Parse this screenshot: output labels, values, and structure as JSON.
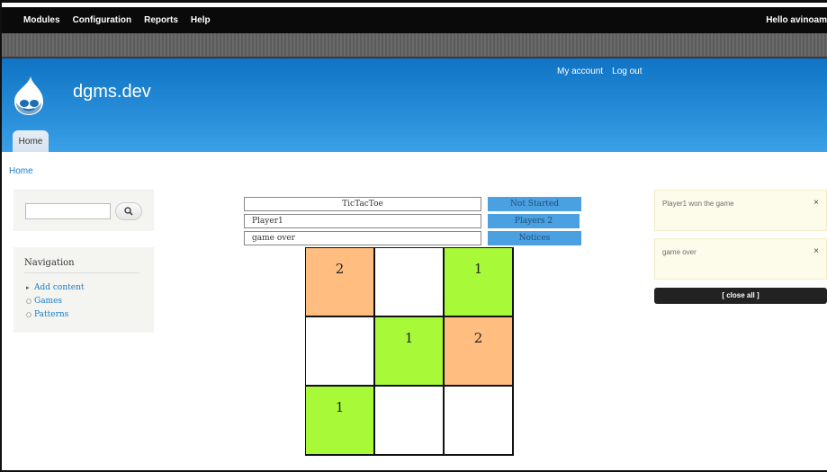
{
  "admin_bar": {
    "menu": [
      "Modules",
      "Configuration",
      "Reports",
      "Help"
    ],
    "hello_prefix": "Hello ",
    "username": "avinoam"
  },
  "header": {
    "site_name": "dgms.dev",
    "my_account": "My account",
    "log_out": "Log out",
    "tab_home": "Home",
    "logo_icon": "drupal-drop-icon"
  },
  "breadcrumb": "Home",
  "search": {
    "value": "",
    "button_icon": "search-icon"
  },
  "navigation": {
    "title": "Navigation",
    "items": [
      "Add content",
      "Games",
      "Patterns"
    ]
  },
  "game": {
    "name": "TicTacToe",
    "player": "Player1",
    "status_text": "game over",
    "state_button": "Not Started",
    "players_button": "Players 2",
    "notices_button": "Notices"
  },
  "board": {
    "cells": [
      "2",
      "",
      "1",
      "",
      "1",
      "2",
      "1",
      "",
      ""
    ],
    "colors": [
      "#ffbd80",
      "#ffffff",
      "#a8fa39",
      "#ffffff",
      "#a8fa39",
      "#ffbd80",
      "#a8fa39",
      "#ffffff",
      "#ffffff"
    ]
  },
  "notices": {
    "items": [
      "Player1 won the game",
      "game over"
    ],
    "close_symbol": "×",
    "close_all": "[ close all ]"
  }
}
